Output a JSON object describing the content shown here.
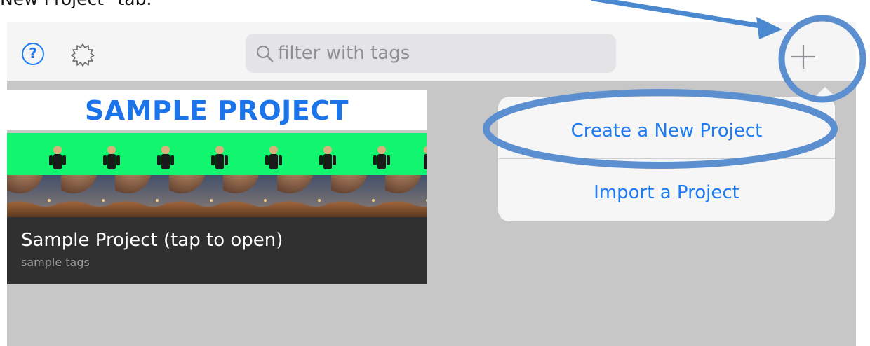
{
  "caption": "New Project\" tab.",
  "toolbar": {
    "help_label": "?",
    "search_placeholder": "filter with tags"
  },
  "project_card": {
    "title_banner": "SAMPLE PROJECT",
    "name": "Sample Project (tap to open)",
    "tags": "sample tags"
  },
  "add_menu": {
    "create_label": "Create a New Project",
    "import_label": "Import a Project"
  },
  "icons": {
    "help": "question-circle-icon",
    "settings": "gear-icon",
    "search": "magnifier-icon",
    "add": "plus-icon"
  },
  "colors": {
    "accent": "#1e7cf2",
    "annotation": "#4a89cf",
    "greenscreen": "#12f56f",
    "card_footer": "#303030"
  }
}
